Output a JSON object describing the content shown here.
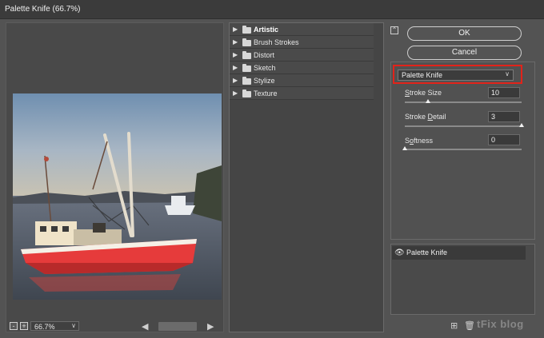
{
  "window": {
    "title": "Palette Knife (66.7%)"
  },
  "zoom": {
    "value": "66.7%",
    "minus": "-",
    "plus": "+",
    "caret": "∨"
  },
  "browser": {
    "categories": [
      {
        "label": "Artistic",
        "expanded": false,
        "selected": true
      },
      {
        "label": "Brush Strokes"
      },
      {
        "label": "Distort"
      },
      {
        "label": "Sketch"
      },
      {
        "label": "Stylize"
      },
      {
        "label": "Texture"
      }
    ]
  },
  "buttons": {
    "ok": "OK",
    "cancel": "Cancel",
    "collapse": "⌃"
  },
  "filter": {
    "selected": "Palette Knife",
    "caret": "∨"
  },
  "params": {
    "stroke_size": {
      "label_pre": "",
      "label_u": "S",
      "label_post": "troke Size",
      "value": "10",
      "level": 0.2
    },
    "stroke_detail": {
      "label_pre": "Stroke ",
      "label_u": "D",
      "label_post": "etail",
      "value": "3",
      "level": 1.0
    },
    "softness": {
      "label_pre": "S",
      "label_u": "o",
      "label_post": "ftness",
      "value": "0",
      "level": 0.0
    }
  },
  "layers": {
    "items": [
      {
        "label": "Palette Knife",
        "visible": true
      }
    ]
  },
  "watermark": "tFix blog",
  "icons": {
    "new_layer": "new-layer-icon",
    "delete_layer": "trash-icon",
    "eye": "eye-icon"
  }
}
